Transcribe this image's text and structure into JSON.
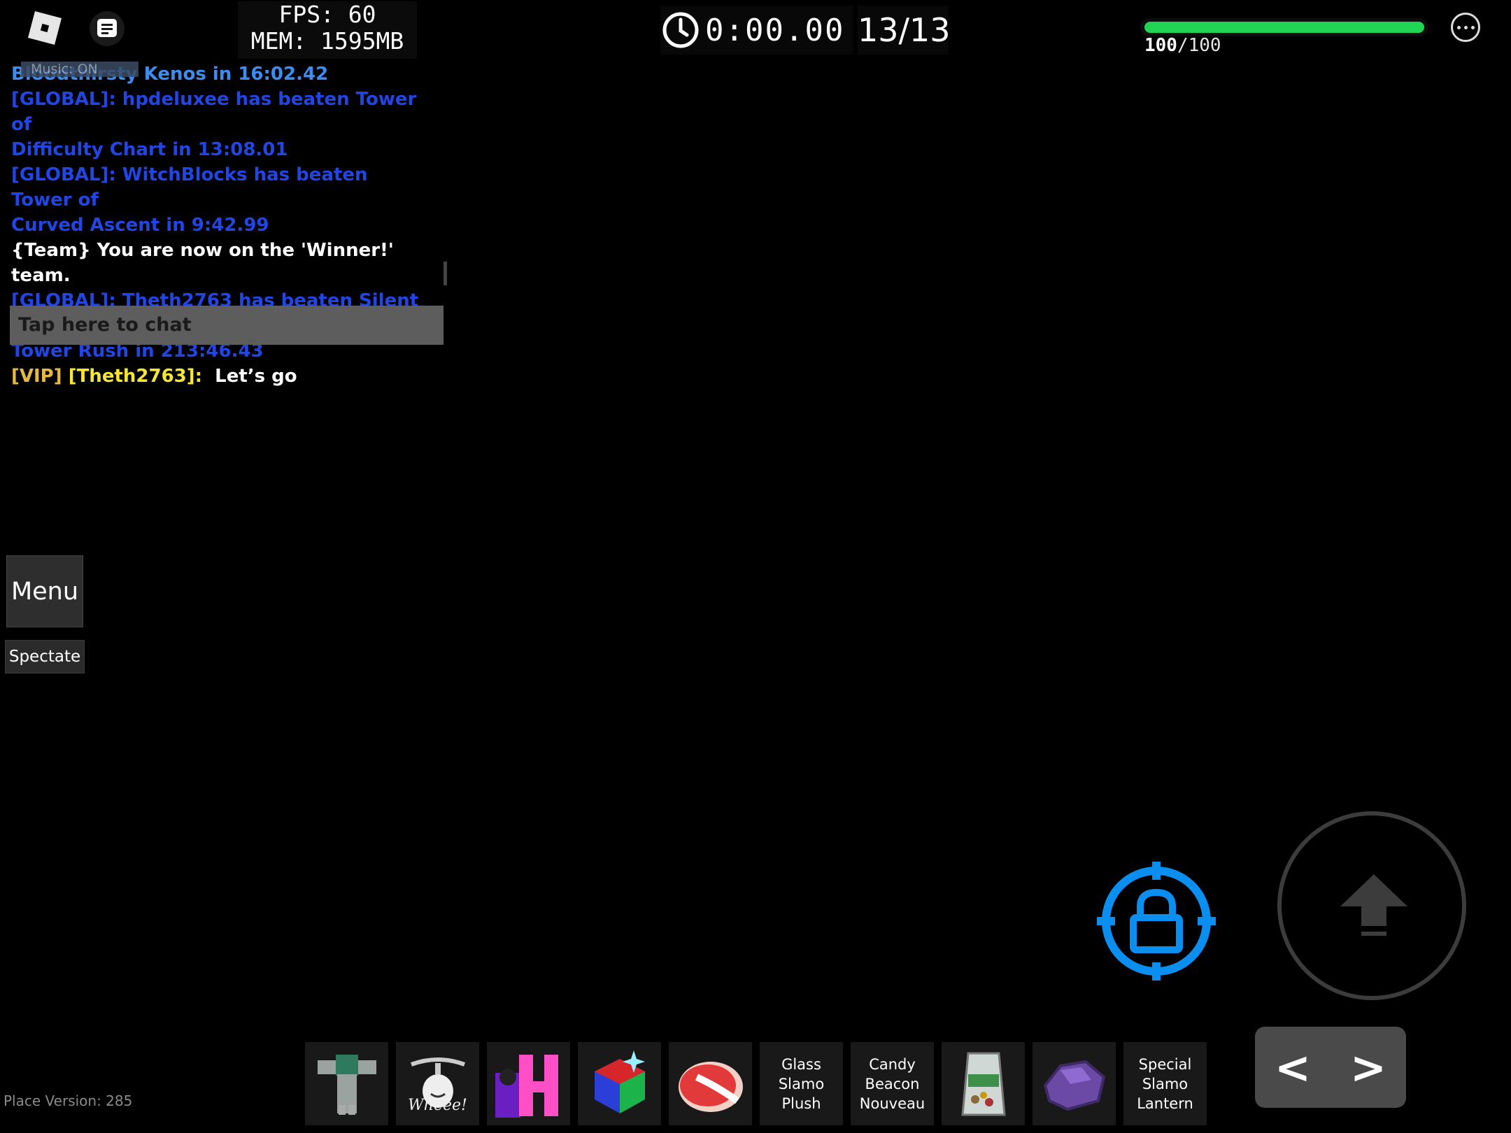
{
  "topbar": {
    "fps_label": "FPS: 60",
    "mem_label": "MEM: 1595MB",
    "timer": "0:00.00",
    "stage": "13/13",
    "health_current": "100",
    "health_max": "/100",
    "health_fraction": 1.0,
    "health_color": "#21d454"
  },
  "chat": {
    "music_tag": "Music: ON",
    "lines": [
      {
        "text": "Bloodthirsty Kenos in 16:02.42"
      },
      {
        "text": "[GLOBAL]: hpdeluxee has beaten Tower of"
      },
      {
        "text": "Difficulty Chart in 13:08.01"
      },
      {
        "text": "[GLOBAL]: WitchBlocks has beaten Tower of"
      },
      {
        "text": "Curved Ascent in 9:42.99"
      },
      {
        "text": "{Team} You are now on the 'Winner!' team."
      },
      {
        "text": "[GLOBAL]: Theth2763 has beaten Silent Abyss"
      },
      {
        "text": "Tower Rush in 213:46.43"
      }
    ],
    "vip_tag": "[VIP]",
    "vip_name": "[Theth2763]:",
    "vip_message": "Let’s go",
    "input_placeholder": "Tap here to chat"
  },
  "left_buttons": {
    "menu": "Menu",
    "spectate": "Spectate"
  },
  "place_version": "Place Version: 285",
  "hotbar": {
    "slots": [
      {
        "icon": "gravity-coil-shirt-icon"
      },
      {
        "icon": "wheee-heli-icon",
        "caption": "Wheee!"
      },
      {
        "icon": "h-badge-icon"
      },
      {
        "icon": "gem-cube-icon"
      },
      {
        "icon": "red-slime-icon"
      },
      {
        "label1": "Glass",
        "label2": "Slamo",
        "label3": "Plush"
      },
      {
        "label1": "Candy",
        "label2": "Beacon",
        "label3": "Nouveau"
      },
      {
        "icon": "trail-mix-bag-icon"
      },
      {
        "icon": "purple-rock-icon"
      },
      {
        "label1": "Special",
        "label2": "Slamo",
        "label3": "Lantern"
      }
    ]
  },
  "controls": {
    "shiftlock_icon": "padlock-icon",
    "jump_icon": "up-arrow-icon",
    "nav_prev": "<",
    "nav_next": ">"
  }
}
